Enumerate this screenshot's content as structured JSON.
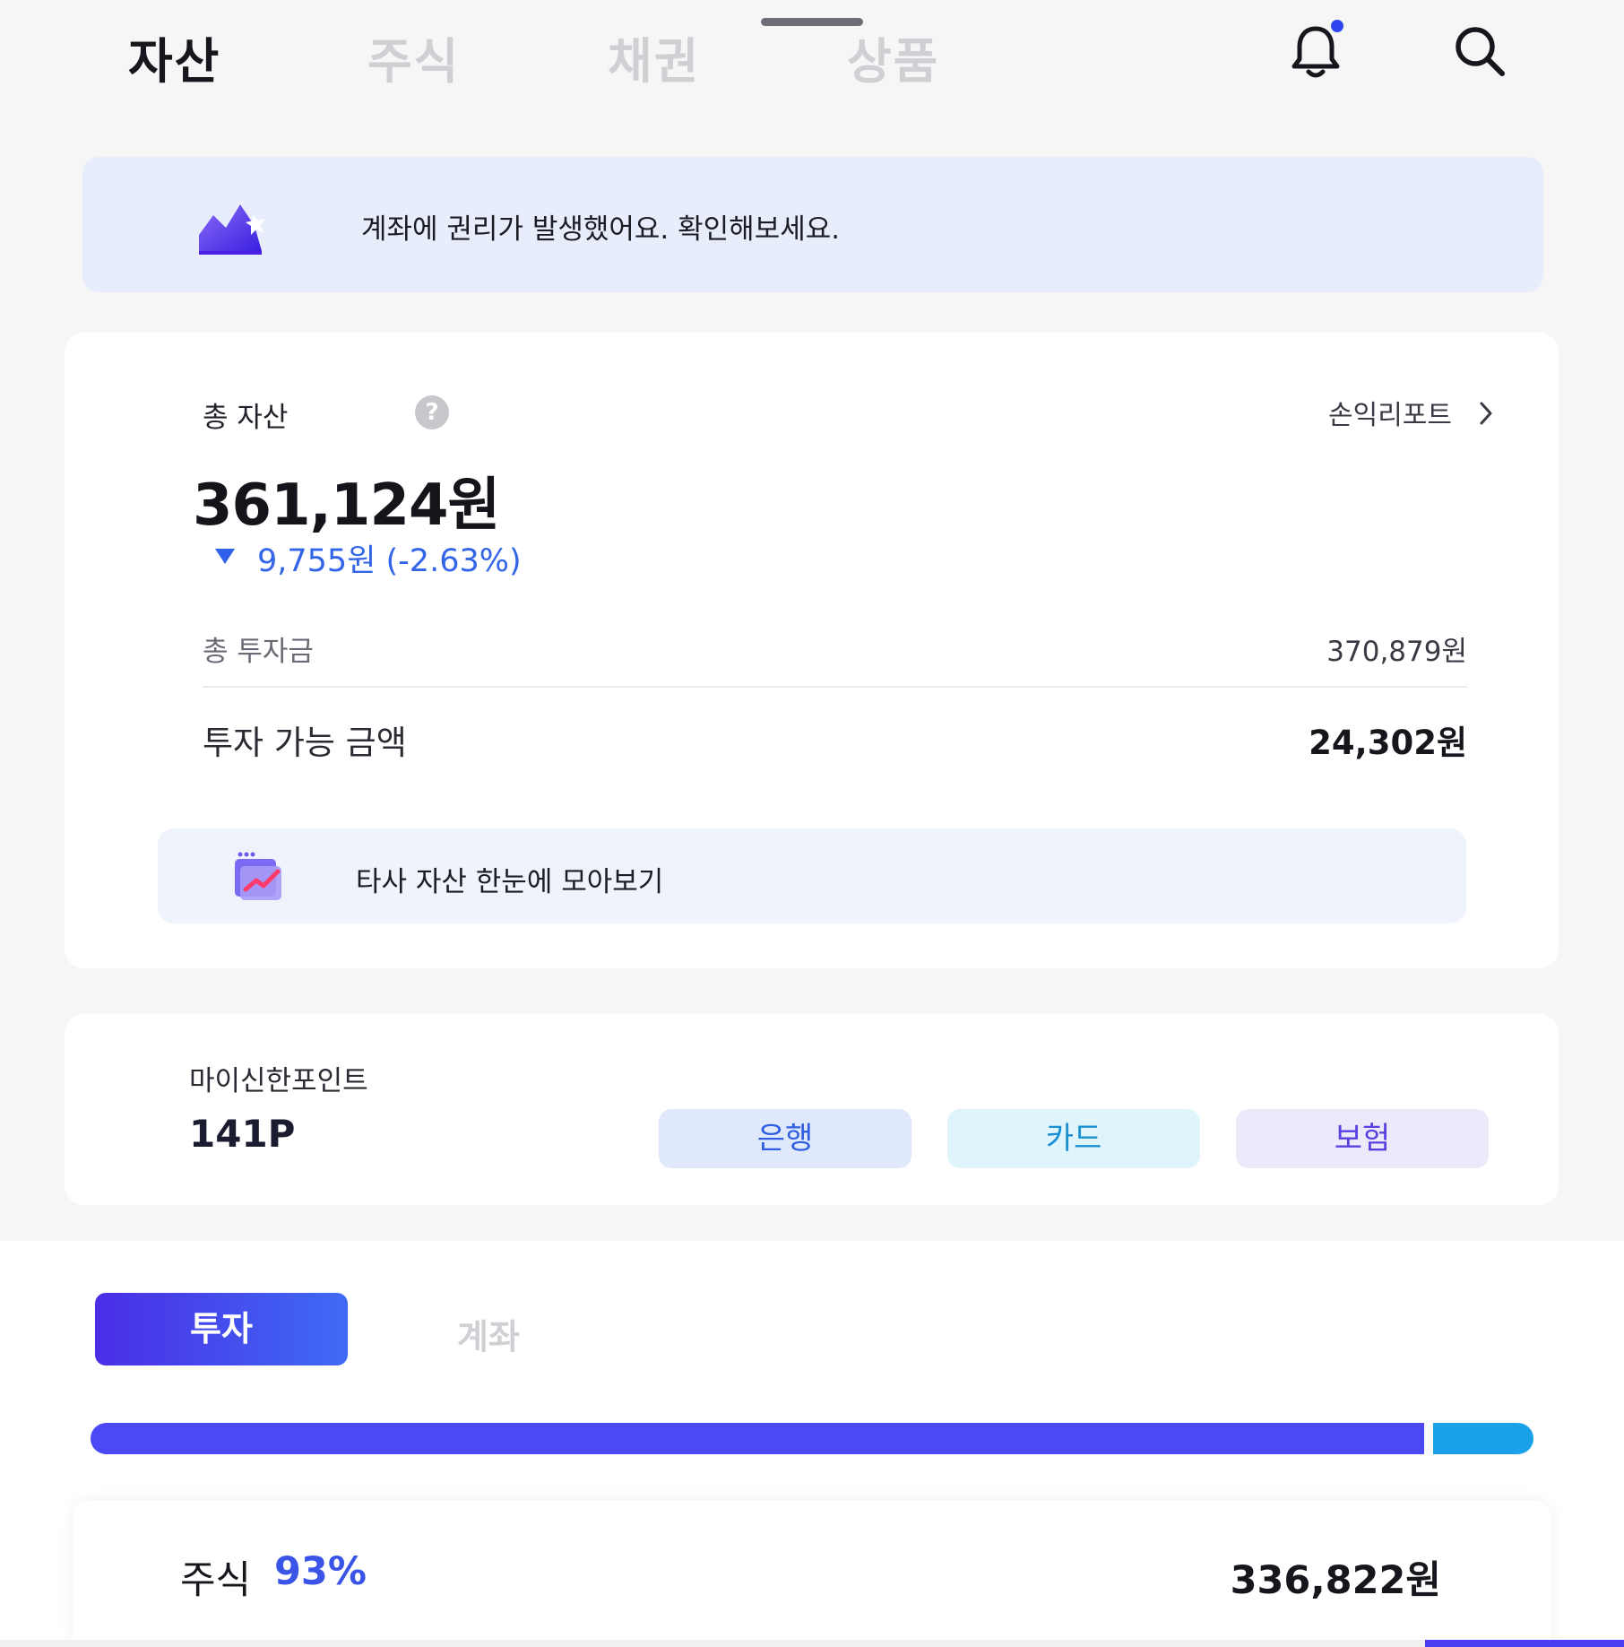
{
  "top_tabs": [
    {
      "label": "자산",
      "active": true
    },
    {
      "label": "주식",
      "active": false
    },
    {
      "label": "채권",
      "active": false
    },
    {
      "label": "상품",
      "active": false
    }
  ],
  "header_icons": {
    "notification": "bell-icon",
    "search": "search-icon"
  },
  "notice": {
    "text": "계좌에 권리가 발생했어요. 확인해보세요.",
    "icon": "chart-mountain-icon"
  },
  "assets": {
    "total_label": "총 자산",
    "help_glyph": "?",
    "report_link": "손익리포트",
    "total_amount": "361,124원",
    "change_text": "9,755원 (-2.63%)",
    "invested_label": "총 투자금",
    "invested_value": "370,879원",
    "available_label": "투자 가능 금액",
    "available_value": "24,302원",
    "other_assets_text": "타사 자산 한눈에 모아보기"
  },
  "points": {
    "label": "마이신한포인트",
    "value": "141P",
    "buttons": [
      "은행",
      "카드",
      "보험"
    ]
  },
  "segment": {
    "invest_label": "투자",
    "account_label": "계좌"
  },
  "allocation": {
    "stock_fraction": 0.93
  },
  "stock_row": {
    "label": "주식",
    "percent": "93%",
    "value": "336,822원"
  },
  "colors": {
    "accent": "#4b48f5",
    "secondary": "#1ba1ea",
    "down": "#3265e8"
  }
}
